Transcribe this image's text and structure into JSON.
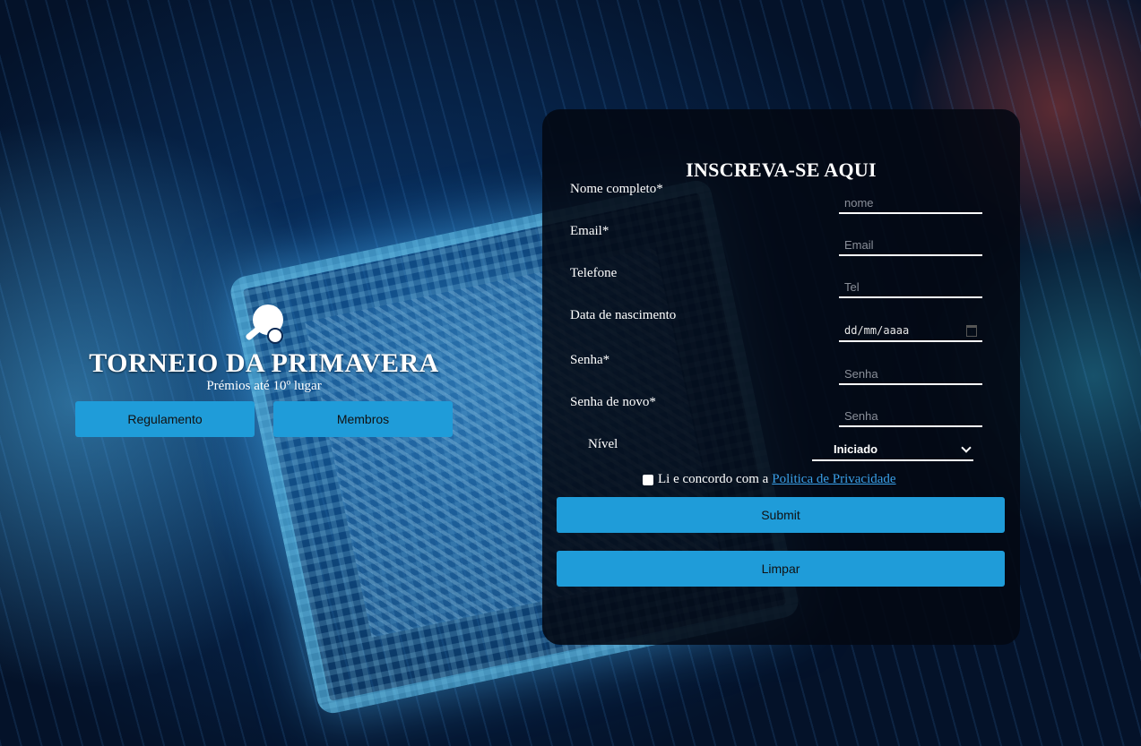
{
  "hero": {
    "title": "TORNEIO DA PRIMAVERA",
    "subtitle": "Prémios até 10º lugar",
    "buttons": {
      "rules": "Regulamento",
      "members": "Membros"
    },
    "logo_icon": "ping-pong-icon"
  },
  "form": {
    "title": "INSCREVA-SE AQUI",
    "fields": {
      "name": {
        "label": "Nome completo*",
        "placeholder": "nome"
      },
      "email": {
        "label": "Email*",
        "placeholder": "Email"
      },
      "phone": {
        "label": "Telefone",
        "placeholder": "Tel"
      },
      "birthdate": {
        "label": "Data de nascimento",
        "value": "dd/mm/aaaa"
      },
      "password": {
        "label": "Senha*",
        "placeholder": "Senha"
      },
      "password_confirm": {
        "label": "Senha de novo*",
        "placeholder": "Senha"
      },
      "level": {
        "label": "Nível",
        "value": "Iniciado"
      }
    },
    "consent": {
      "text": "Li e concordo com a",
      "link": "Politica de Privacidade",
      "checked": false
    },
    "submit_label": "Submit",
    "clear_label": "Limpar"
  },
  "colors": {
    "accent": "#1f9cd9",
    "link": "#3aa0e8",
    "panel": "#03080f"
  }
}
